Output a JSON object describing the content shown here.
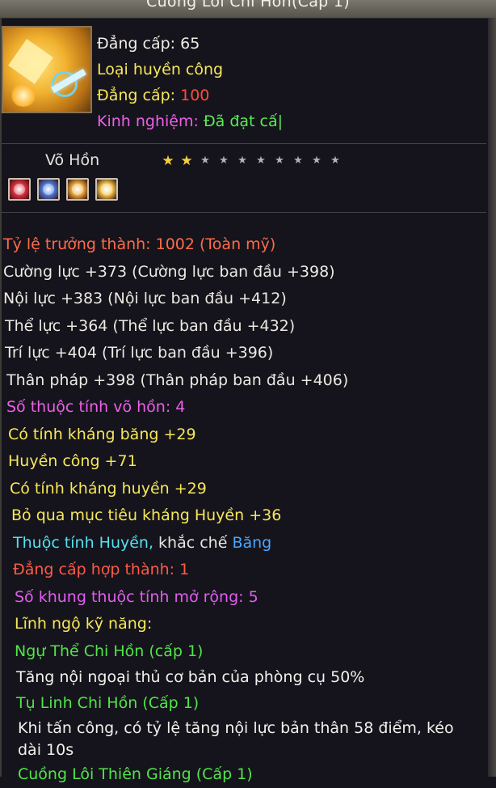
{
  "title": "Cuồng Lôi Chi Hồn(Cấp 1)",
  "header": {
    "item_level": "Đẳng cấp: 65",
    "type": "Loại huyền công",
    "level_label": "Đẳng cấp: ",
    "level_value": "100",
    "exp_label": "Kinh nghiệm: ",
    "exp_value": "Đã đạt cấ|"
  },
  "vo_hon": {
    "label": "Võ Hồn",
    "stars_filled": 2,
    "stars_total": 10
  },
  "gems": [
    {
      "icon": "red-gem-icon",
      "color": "#d83040"
    },
    {
      "icon": "blue-gem-icon",
      "color": "#4a78d8"
    },
    {
      "icon": "gold-face-gem-icon",
      "color": "#e8a73a"
    },
    {
      "icon": "yellow-face-gem-icon",
      "color": "#f0c24a"
    }
  ],
  "lines": [
    {
      "text": "Tỷ lệ trưởng thành: 1002 (Toàn mỹ)",
      "color": "#ff6b4a"
    },
    {
      "text": "Cường lực +373 (Cường lực ban đầu +398)",
      "color": "#ece9e2"
    },
    {
      "text": "Nội lực +383 (Nội lực ban đầu +412)",
      "color": "#ece9e2"
    },
    {
      "text": "Thể lực +364 (Thể lực ban đầu +432)",
      "color": "#ece9e2"
    },
    {
      "text": "Trí lực +404 (Trí lực ban đầu +396)",
      "color": "#ece9e2"
    },
    {
      "text": "Thân pháp +398 (Thân pháp ban đầu +406)",
      "color": "#ece9e2"
    },
    {
      "text": "Số thuộc tính võ hồn: 4",
      "color": "#ee5fe8"
    },
    {
      "text": "Có tính kháng băng +29",
      "color": "#f6e75a"
    },
    {
      "text": "Huyền công +71",
      "color": "#f6e75a"
    },
    {
      "text": "Có tính kháng huyền +29",
      "color": "#f6e75a"
    },
    {
      "text": "Bỏ qua mục tiêu kháng Huyền +36",
      "color": "#f6e75a"
    }
  ],
  "element_line": {
    "part1": "Thuộc tính Huyền,",
    "part2": " khắc chế",
    "part3": " Băng",
    "color1": "#55e0f0",
    "color2": "#e9e6e0",
    "color3": "#4aa6ff"
  },
  "lines2": [
    {
      "text": "Đẳng cấp hợp thành: 1",
      "color": "#ff5a45"
    },
    {
      "text": "Số khung thuộc tính mở rộng: 5",
      "color": "#e25df0"
    },
    {
      "text": "Lĩnh ngộ kỹ năng:",
      "color": "#f6e75a"
    }
  ],
  "skills": [
    {
      "name": "Ngự Thể Chi Hồn (cấp 1)",
      "desc": "Tăng nội ngoại thủ cơ bản của phòng cụ 50%"
    },
    {
      "name": "Tụ Linh Chi Hồn (Cấp 1)",
      "desc": "Khi tấn công, có tỷ lệ tăng nội lực bản thân 58 điểm, kéo dài 10s"
    },
    {
      "name": "Cuồng Lôi Thiên Giáng (Cấp 1)",
      "desc": ""
    }
  ],
  "colors": {
    "skill_name": "#52e44a",
    "skill_desc": "#f3f1ec",
    "level_value": "#ff4c3c",
    "exp_label": "#ee5fe8",
    "exp_value": "#58ee52",
    "header_text": "#f6e75a"
  }
}
